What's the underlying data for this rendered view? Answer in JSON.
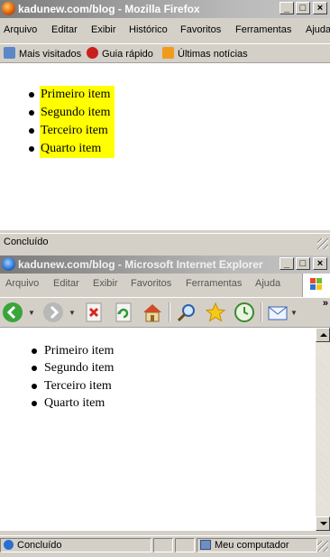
{
  "firefox": {
    "title": "kadunew.com/blog - Mozilla Firefox",
    "menu": [
      "Arquivo",
      "Editar",
      "Exibir",
      "Histórico",
      "Favoritos",
      "Ferramentas",
      "Ajuda"
    ],
    "bookmarks": [
      "Mais visitados",
      "Guia rápido",
      "Últimas notícias"
    ],
    "list_items": [
      "Primeiro item",
      "Segundo item",
      "Terceiro item",
      "Quarto item"
    ],
    "list_highlight_color": "#ffff00",
    "status": "Concluído"
  },
  "ie": {
    "title": "kadunew.com/blog - Microsoft Internet Explorer",
    "menu": [
      "Arquivo",
      "Editar",
      "Exibir",
      "Favoritos",
      "Ferramentas",
      "Ajuda"
    ],
    "toolbar_icons": [
      "back-icon",
      "forward-icon",
      "stop-icon",
      "refresh-icon",
      "home-icon",
      "search-icon",
      "favorites-icon",
      "history-icon",
      "mail-icon"
    ],
    "list_items": [
      "Primeiro item",
      "Segundo item",
      "Terceiro item",
      "Quarto item"
    ],
    "status": "Concluído",
    "zone": "Meu computador"
  },
  "window_controls": [
    "minimize",
    "maximize",
    "close"
  ]
}
